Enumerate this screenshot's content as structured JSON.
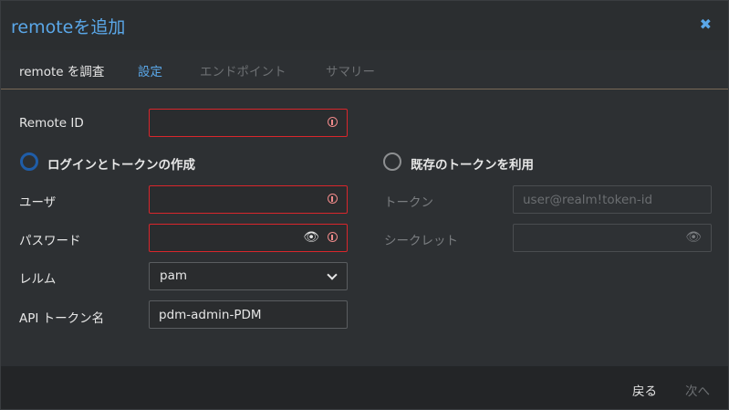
{
  "dialog": {
    "title": "remoteを追加"
  },
  "tabs": [
    {
      "label": "remote を調査",
      "state": "done"
    },
    {
      "label": "設定",
      "state": "active"
    },
    {
      "label": "エンドポイント",
      "state": "disabled"
    },
    {
      "label": "サマリー",
      "state": "disabled"
    }
  ],
  "form": {
    "remote_id": {
      "label": "Remote ID",
      "value": "",
      "invalid": true
    },
    "auth_options": {
      "login": {
        "label": "ログインとトークンの作成",
        "checked": true
      },
      "existing": {
        "label": "既存のトークンを利用",
        "checked": false
      }
    },
    "user": {
      "label": "ユーザ",
      "value": "",
      "invalid": true
    },
    "password": {
      "label": "パスワード",
      "value": "",
      "invalid": true
    },
    "realm": {
      "label": "レルム",
      "value": "pam"
    },
    "api_token_name": {
      "label": "API トークン名",
      "value": "pdm-admin-PDM"
    },
    "token": {
      "label": "トークン",
      "placeholder": "user@realm!token-id",
      "disabled": true
    },
    "secret": {
      "label": "シークレット",
      "value": "",
      "disabled": true
    }
  },
  "footer": {
    "back_label": "戻る",
    "next_label": "次へ"
  },
  "colors": {
    "accent": "#5aa7e8",
    "error": "#d9262c",
    "radio_checked": "#1f5da8"
  }
}
